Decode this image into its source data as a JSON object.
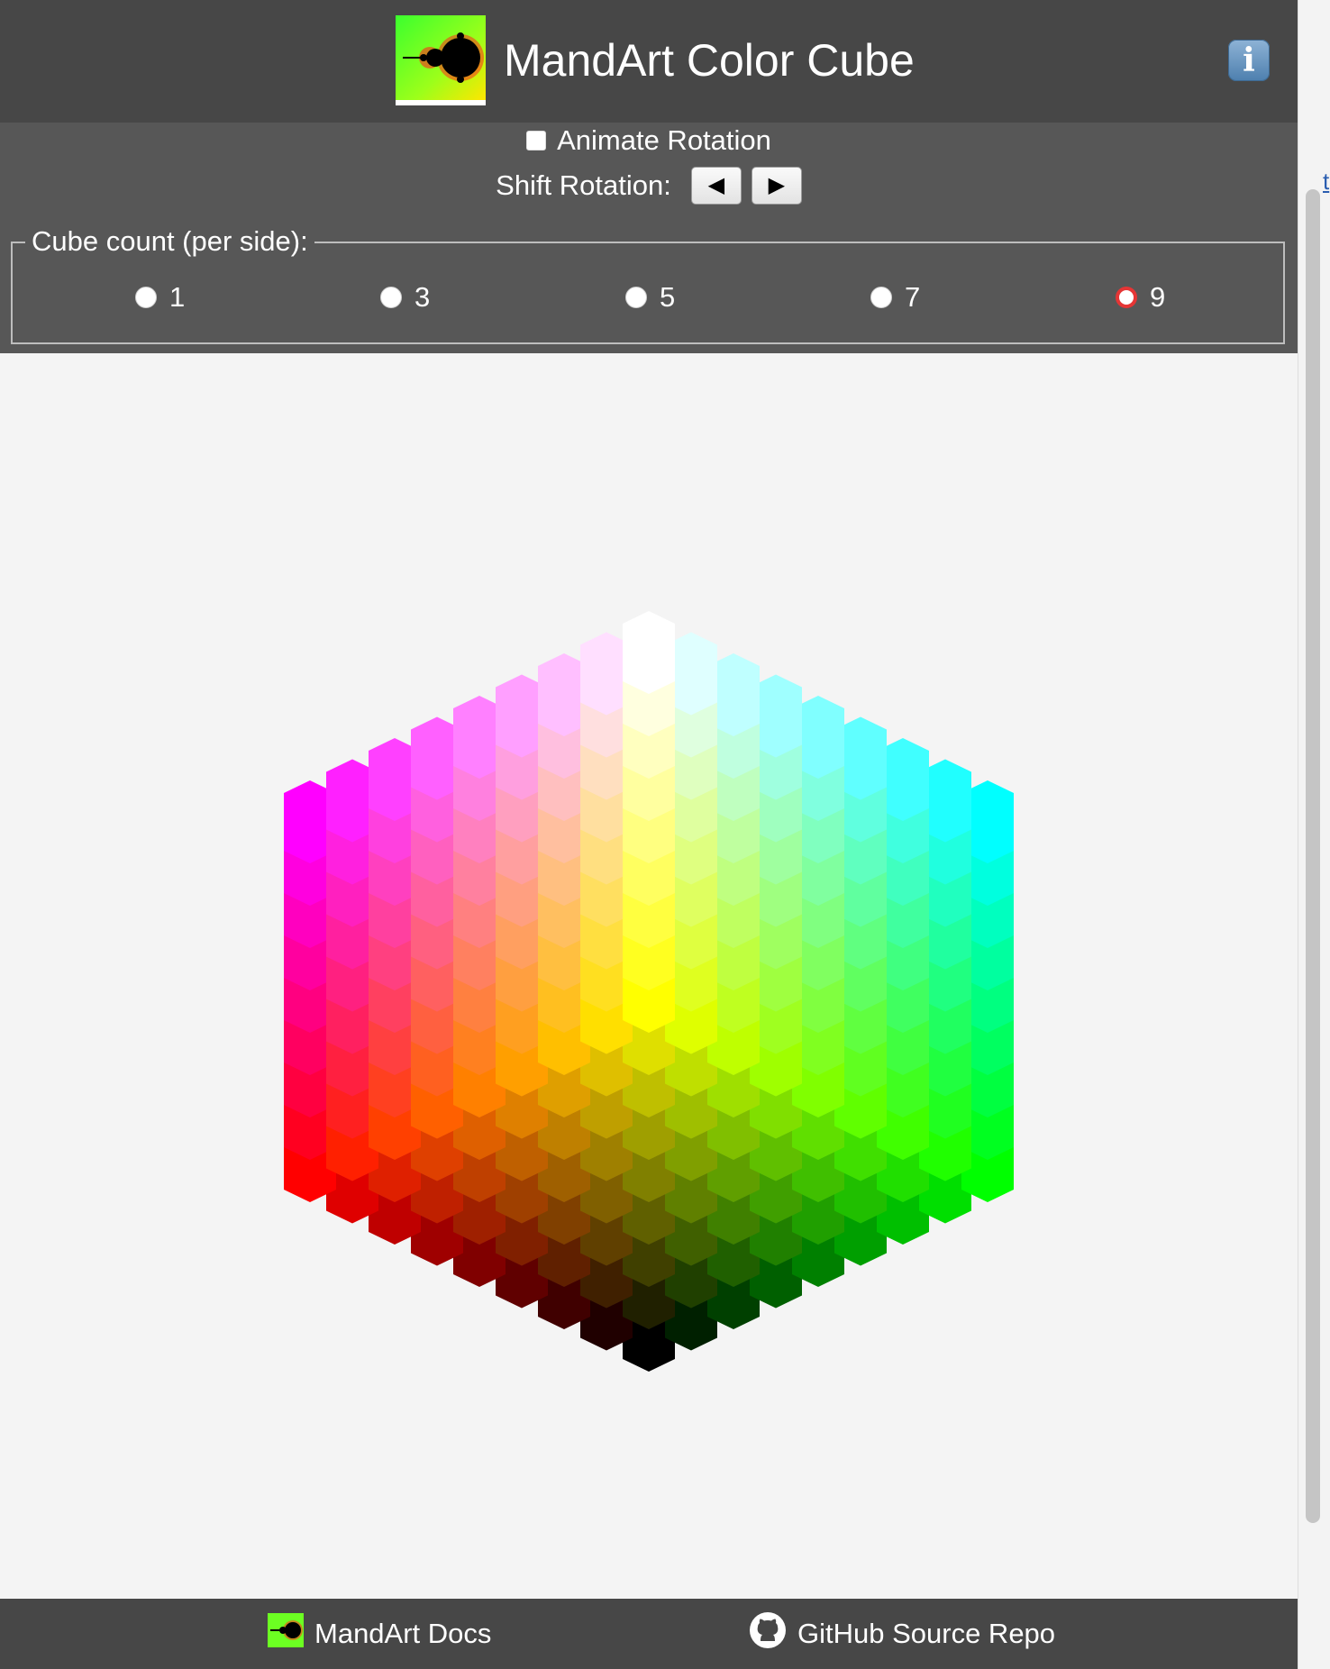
{
  "header": {
    "title": "MandArt Color Cube",
    "logo_icon": "mandelbrot-logo-icon",
    "info_icon": "info-icon",
    "info_label": "i"
  },
  "controls": {
    "animate_label": "Animate Rotation",
    "animate_checked": false,
    "shift_label": "Shift Rotation:",
    "shift_left_label": "◀",
    "shift_right_label": "▶",
    "cube_count_legend": "Cube count (per side):",
    "cube_count_options": [
      "1",
      "3",
      "5",
      "7",
      "9"
    ],
    "cube_count_selected": "9"
  },
  "colors": {
    "header_bg": "#474747",
    "controls_bg": "#575757",
    "canvas_bg": "#f4f4f4",
    "radio_selected": "#e53535"
  },
  "footer": {
    "docs_label": "MandArt Docs",
    "docs_icon": "mandelbrot-logo-icon",
    "repo_label": "GitHub Source Repo",
    "repo_icon": "github-icon"
  },
  "edge_link_text": "t"
}
